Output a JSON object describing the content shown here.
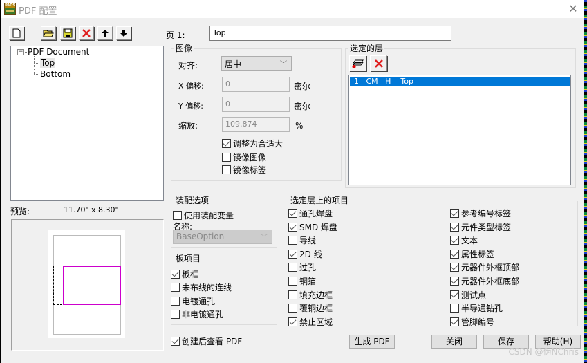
{
  "window": {
    "title": "PDF 配置",
    "app_icon_label": "PADS",
    "close_icon": "close-icon"
  },
  "toolbar": {
    "buttons": [
      {
        "name": "new-page-button",
        "icon": "new-document-icon"
      },
      {
        "name": "open-button",
        "icon": "open-folder-icon"
      },
      {
        "name": "save-config-button",
        "icon": "floppy-disk-icon"
      },
      {
        "name": "delete-button",
        "icon": "red-x-icon"
      },
      {
        "name": "move-up-button",
        "icon": "arrow-up-icon"
      },
      {
        "name": "move-down-button",
        "icon": "arrow-down-icon"
      }
    ]
  },
  "page": {
    "label": "页 1:",
    "value": "Top"
  },
  "tree": {
    "root": "PDF Document",
    "children": [
      "Top",
      "Bottom"
    ],
    "selected": "Top"
  },
  "preview": {
    "label": "预览:",
    "size": "11.70\" x  8.30\""
  },
  "image_group": {
    "title": "图像",
    "align_label": "对齐:",
    "align_value": "居中",
    "x_offset_label": "X 偏移:",
    "x_offset_value": "0",
    "x_unit": "密尔",
    "y_offset_label": "Y 偏移:",
    "y_offset_value": "0",
    "y_unit": "密尔",
    "scale_label": "缩放:",
    "scale_value": "109.874",
    "scale_unit": "%",
    "options": [
      {
        "label": "调整为合适大",
        "checked": true
      },
      {
        "label": "镜像图像",
        "checked": false
      },
      {
        "label": "镜像标签",
        "checked": false
      }
    ]
  },
  "layers_group": {
    "title": "选定的层",
    "add_icon": "add-layer-icon",
    "remove_icon": "remove-layer-icon",
    "rows": [
      {
        "text": "1   CM   H    Top",
        "selected": true
      }
    ]
  },
  "assembly_group": {
    "title": "装配选项",
    "use_variant": {
      "label": "使用装配变量",
      "checked": false
    },
    "name_label": "名称:",
    "name_value": "BaseOption"
  },
  "board_group": {
    "title": "板项目",
    "items": [
      {
        "label": "板框",
        "checked": true
      },
      {
        "label": "未布线的连线",
        "checked": false
      },
      {
        "label": "电镀通孔",
        "checked": false
      },
      {
        "label": "非电镀通孔",
        "checked": false
      }
    ]
  },
  "layer_items_group": {
    "title": "选定层上的项目",
    "left": [
      {
        "label": "通孔焊盘",
        "checked": true
      },
      {
        "label": "SMD 焊盘",
        "checked": true
      },
      {
        "label": "导线",
        "checked": false
      },
      {
        "label": "2D 线",
        "checked": true
      },
      {
        "label": "过孔",
        "checked": false
      },
      {
        "label": "铜箔",
        "checked": false
      },
      {
        "label": "填充边框",
        "checked": false
      },
      {
        "label": "覆铜边框",
        "checked": false
      },
      {
        "label": "禁止区域",
        "checked": true
      }
    ],
    "right": [
      {
        "label": "参考编号标签",
        "checked": true
      },
      {
        "label": "元件类型标签",
        "checked": true
      },
      {
        "label": "文本",
        "checked": true
      },
      {
        "label": "属性标签",
        "checked": true
      },
      {
        "label": "元器件外框顶部",
        "checked": true
      },
      {
        "label": "元器件外框底部",
        "checked": true
      },
      {
        "label": "测试点",
        "checked": true
      },
      {
        "label": "半导通钻孔",
        "checked": false
      },
      {
        "label": "管脚编号",
        "checked": true
      }
    ]
  },
  "footer": {
    "view_after": {
      "label": "创建后查看 PDF",
      "checked": true
    },
    "generate": "生成 PDF",
    "close": "关闭",
    "save": "保存",
    "help": "帮助(H)"
  },
  "watermark": "CSDN @伪NChris",
  "colors": {
    "selection": "#0078d7",
    "board_outline": "#cc00cc"
  }
}
